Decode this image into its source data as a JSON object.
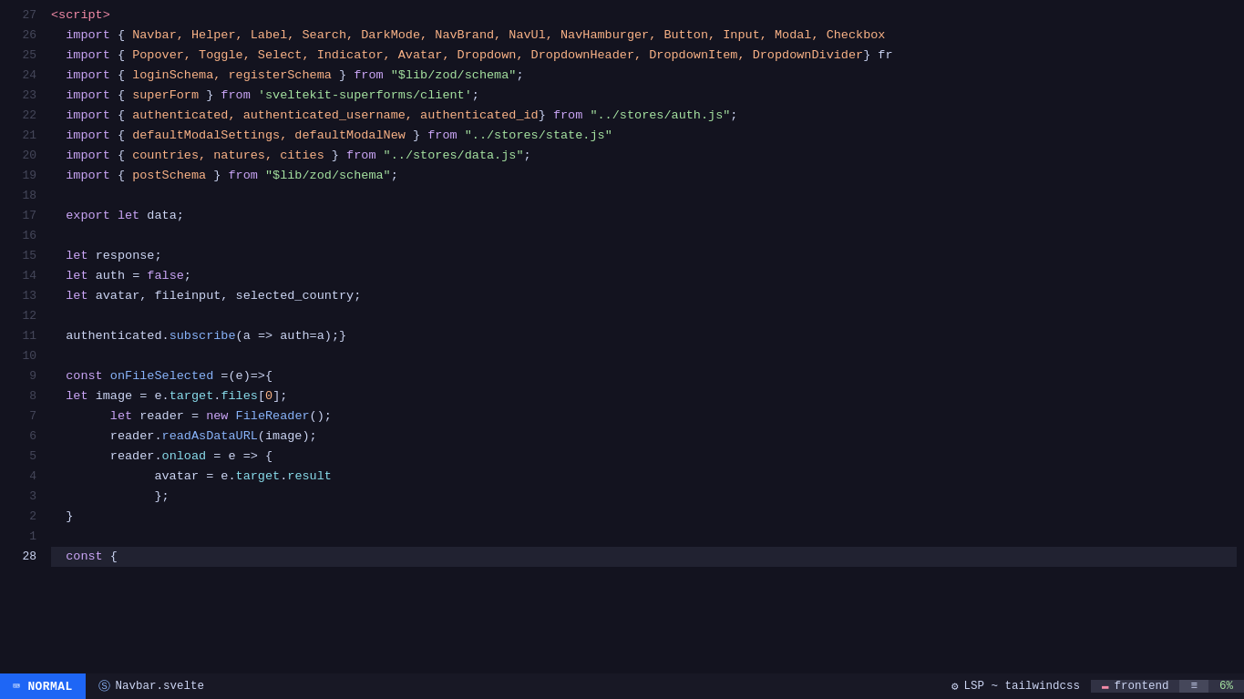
{
  "editor": {
    "background": "#13131f",
    "lines": [
      {
        "num": "27",
        "content": [
          {
            "type": "tag",
            "text": "<script>"
          }
        ]
      },
      {
        "num": "26",
        "content": [
          {
            "type": "plain",
            "text": "  "
          },
          {
            "type": "kw",
            "text": "import"
          },
          {
            "type": "plain",
            "text": " { "
          },
          {
            "type": "obj",
            "text": "Navbar, Helper, Label, Search, DarkMode, NavBrand, NavUl, NavHamburger, Button, Input, Modal, Checkbox"
          }
        ]
      },
      {
        "num": "25",
        "content": [
          {
            "type": "plain",
            "text": "  "
          },
          {
            "type": "kw",
            "text": "import"
          },
          {
            "type": "plain",
            "text": " { "
          },
          {
            "type": "obj",
            "text": "Popover, Toggle, Select, Indicator, Avatar, Dropdown, DropdownHeader, DropdownItem, DropdownDivider"
          },
          {
            "type": "plain",
            "text": "} fr"
          }
        ]
      },
      {
        "num": "24",
        "content": [
          {
            "type": "plain",
            "text": "  "
          },
          {
            "type": "kw",
            "text": "import"
          },
          {
            "type": "plain",
            "text": " { "
          },
          {
            "type": "obj",
            "text": "loginSchema, registerSchema"
          },
          {
            "type": "plain",
            "text": " } "
          },
          {
            "type": "kw",
            "text": "from"
          },
          {
            "type": "plain",
            "text": " "
          },
          {
            "type": "str",
            "text": "\"$lib/zod/schema\""
          },
          {
            "type": "plain",
            "text": ";"
          }
        ]
      },
      {
        "num": "23",
        "content": [
          {
            "type": "plain",
            "text": "  "
          },
          {
            "type": "kw",
            "text": "import"
          },
          {
            "type": "plain",
            "text": " { "
          },
          {
            "type": "obj",
            "text": "superForm"
          },
          {
            "type": "plain",
            "text": " } "
          },
          {
            "type": "kw",
            "text": "from"
          },
          {
            "type": "plain",
            "text": " "
          },
          {
            "type": "str",
            "text": "'sveltekit-superforms/client'"
          },
          {
            "type": "plain",
            "text": ";"
          }
        ]
      },
      {
        "num": "22",
        "content": [
          {
            "type": "plain",
            "text": "  "
          },
          {
            "type": "kw",
            "text": "import"
          },
          {
            "type": "plain",
            "text": " { "
          },
          {
            "type": "obj",
            "text": "authenticated, authenticated_username, authenticated_id"
          },
          {
            "type": "plain",
            "text": "} "
          },
          {
            "type": "kw",
            "text": "from"
          },
          {
            "type": "plain",
            "text": " "
          },
          {
            "type": "str",
            "text": "\"../stores/auth.js\""
          },
          {
            "type": "plain",
            "text": ";"
          }
        ]
      },
      {
        "num": "21",
        "content": [
          {
            "type": "plain",
            "text": "  "
          },
          {
            "type": "kw",
            "text": "import"
          },
          {
            "type": "plain",
            "text": " { "
          },
          {
            "type": "obj",
            "text": "defaultModalSettings, defaultModalNew"
          },
          {
            "type": "plain",
            "text": " } "
          },
          {
            "type": "kw",
            "text": "from"
          },
          {
            "type": "plain",
            "text": " "
          },
          {
            "type": "str",
            "text": "\"../stores/state.js\""
          }
        ]
      },
      {
        "num": "20",
        "content": [
          {
            "type": "plain",
            "text": "  "
          },
          {
            "type": "kw",
            "text": "import"
          },
          {
            "type": "plain",
            "text": " { "
          },
          {
            "type": "obj",
            "text": "countries, natures, cities"
          },
          {
            "type": "plain",
            "text": " } "
          },
          {
            "type": "kw",
            "text": "from"
          },
          {
            "type": "plain",
            "text": " "
          },
          {
            "type": "str",
            "text": "\"../stores/data.js\""
          },
          {
            "type": "plain",
            "text": ";"
          }
        ]
      },
      {
        "num": "19",
        "content": [
          {
            "type": "plain",
            "text": "  "
          },
          {
            "type": "kw",
            "text": "import"
          },
          {
            "type": "plain",
            "text": " { "
          },
          {
            "type": "obj",
            "text": "postSchema"
          },
          {
            "type": "plain",
            "text": " } "
          },
          {
            "type": "kw",
            "text": "from"
          },
          {
            "type": "plain",
            "text": " "
          },
          {
            "type": "str",
            "text": "\"$lib/zod/schema\""
          },
          {
            "type": "plain",
            "text": ";"
          }
        ]
      },
      {
        "num": "18",
        "content": []
      },
      {
        "num": "17",
        "content": [
          {
            "type": "plain",
            "text": "  "
          },
          {
            "type": "kw",
            "text": "export"
          },
          {
            "type": "plain",
            "text": " "
          },
          {
            "type": "kw",
            "text": "let"
          },
          {
            "type": "plain",
            "text": " "
          },
          {
            "type": "var",
            "text": "data"
          },
          {
            "type": "plain",
            "text": ";"
          }
        ]
      },
      {
        "num": "16",
        "content": []
      },
      {
        "num": "15",
        "content": [
          {
            "type": "plain",
            "text": "  "
          },
          {
            "type": "kw",
            "text": "let"
          },
          {
            "type": "plain",
            "text": " "
          },
          {
            "type": "var",
            "text": "response"
          },
          {
            "type": "plain",
            "text": ";"
          }
        ]
      },
      {
        "num": "14",
        "content": [
          {
            "type": "plain",
            "text": "  "
          },
          {
            "type": "kw",
            "text": "let"
          },
          {
            "type": "plain",
            "text": " "
          },
          {
            "type": "var",
            "text": "auth"
          },
          {
            "type": "plain",
            "text": " = "
          },
          {
            "type": "kw",
            "text": "false"
          },
          {
            "type": "plain",
            "text": ";"
          }
        ]
      },
      {
        "num": "13",
        "content": [
          {
            "type": "plain",
            "text": "  "
          },
          {
            "type": "kw",
            "text": "let"
          },
          {
            "type": "plain",
            "text": " "
          },
          {
            "type": "var",
            "text": "avatar, fileinput, selected_country"
          },
          {
            "type": "plain",
            "text": ";"
          }
        ]
      },
      {
        "num": "12",
        "content": []
      },
      {
        "num": "11",
        "content": [
          {
            "type": "plain",
            "text": "  "
          },
          {
            "type": "var",
            "text": "authenticated"
          },
          {
            "type": "plain",
            "text": "."
          },
          {
            "type": "fn",
            "text": "subscribe"
          },
          {
            "type": "plain",
            "text": "("
          },
          {
            "type": "var",
            "text": "a"
          },
          {
            "type": "plain",
            "text": " => "
          },
          {
            "type": "var",
            "text": "auth"
          },
          {
            "type": "plain",
            "text": "="
          },
          {
            "type": "var",
            "text": "a"
          },
          {
            "type": "plain",
            "text": ");}"
          }
        ]
      },
      {
        "num": "10",
        "content": []
      },
      {
        "num": "9",
        "content": [
          {
            "type": "plain",
            "text": "  "
          },
          {
            "type": "kw",
            "text": "const"
          },
          {
            "type": "plain",
            "text": " "
          },
          {
            "type": "fn",
            "text": "onFileSelected"
          },
          {
            "type": "plain",
            "text": " =("
          },
          {
            "type": "var",
            "text": "e"
          },
          {
            "type": "plain",
            "text": ")=>{"
          }
        ]
      },
      {
        "num": "8",
        "content": [
          {
            "type": "plain",
            "text": "  "
          },
          {
            "type": "kw",
            "text": "let"
          },
          {
            "type": "plain",
            "text": " "
          },
          {
            "type": "var",
            "text": "image"
          },
          {
            "type": "plain",
            "text": " = "
          },
          {
            "type": "var",
            "text": "e"
          },
          {
            "type": "plain",
            "text": "."
          },
          {
            "type": "prop",
            "text": "target"
          },
          {
            "type": "plain",
            "text": "."
          },
          {
            "type": "prop",
            "text": "files"
          },
          {
            "type": "plain",
            "text": "["
          },
          {
            "type": "num",
            "text": "0"
          },
          {
            "type": "plain",
            "text": "];"
          }
        ]
      },
      {
        "num": "7",
        "content": [
          {
            "type": "plain",
            "text": "        "
          },
          {
            "type": "kw",
            "text": "let"
          },
          {
            "type": "plain",
            "text": " "
          },
          {
            "type": "var",
            "text": "reader"
          },
          {
            "type": "plain",
            "text": " = "
          },
          {
            "type": "kw",
            "text": "new"
          },
          {
            "type": "plain",
            "text": " "
          },
          {
            "type": "fn",
            "text": "FileReader"
          },
          {
            "type": "plain",
            "text": "();"
          }
        ]
      },
      {
        "num": "6",
        "content": [
          {
            "type": "plain",
            "text": "        "
          },
          {
            "type": "var",
            "text": "reader"
          },
          {
            "type": "plain",
            "text": "."
          },
          {
            "type": "fn",
            "text": "readAsDataURL"
          },
          {
            "type": "plain",
            "text": "("
          },
          {
            "type": "var",
            "text": "image"
          },
          {
            "type": "plain",
            "text": ");"
          }
        ]
      },
      {
        "num": "5",
        "content": [
          {
            "type": "plain",
            "text": "        "
          },
          {
            "type": "var",
            "text": "reader"
          },
          {
            "type": "plain",
            "text": "."
          },
          {
            "type": "prop",
            "text": "onload"
          },
          {
            "type": "plain",
            "text": " = "
          },
          {
            "type": "var",
            "text": "e"
          },
          {
            "type": "plain",
            "text": " => {"
          }
        ]
      },
      {
        "num": "4",
        "content": [
          {
            "type": "plain",
            "text": "              "
          },
          {
            "type": "var",
            "text": "avatar"
          },
          {
            "type": "plain",
            "text": " = "
          },
          {
            "type": "var",
            "text": "e"
          },
          {
            "type": "plain",
            "text": "."
          },
          {
            "type": "prop",
            "text": "target"
          },
          {
            "type": "plain",
            "text": "."
          },
          {
            "type": "prop",
            "text": "result"
          }
        ]
      },
      {
        "num": "3",
        "content": [
          {
            "type": "plain",
            "text": "              "
          },
          {
            "type": "plain",
            "text": "};"
          }
        ]
      },
      {
        "num": "2",
        "content": [
          {
            "type": "plain",
            "text": "  }"
          }
        ]
      },
      {
        "num": "1",
        "content": []
      },
      {
        "num": "28",
        "content": [
          {
            "type": "plain",
            "text": "  "
          },
          {
            "type": "kw",
            "text": "const"
          },
          {
            "type": "plain",
            "text": " {"
          }
        ]
      }
    ]
  },
  "statusbar": {
    "mode": "NORMAL",
    "vim_icon": "⌨",
    "file_icon": "Ⓢ",
    "filename": "Navbar.svelte",
    "lsp_icon": "⚙",
    "lsp_text": "LSP ~ tailwindcss",
    "branch_icon": "▬",
    "branch_text": "frontend",
    "list_icon": "≡",
    "percent": "6%"
  }
}
